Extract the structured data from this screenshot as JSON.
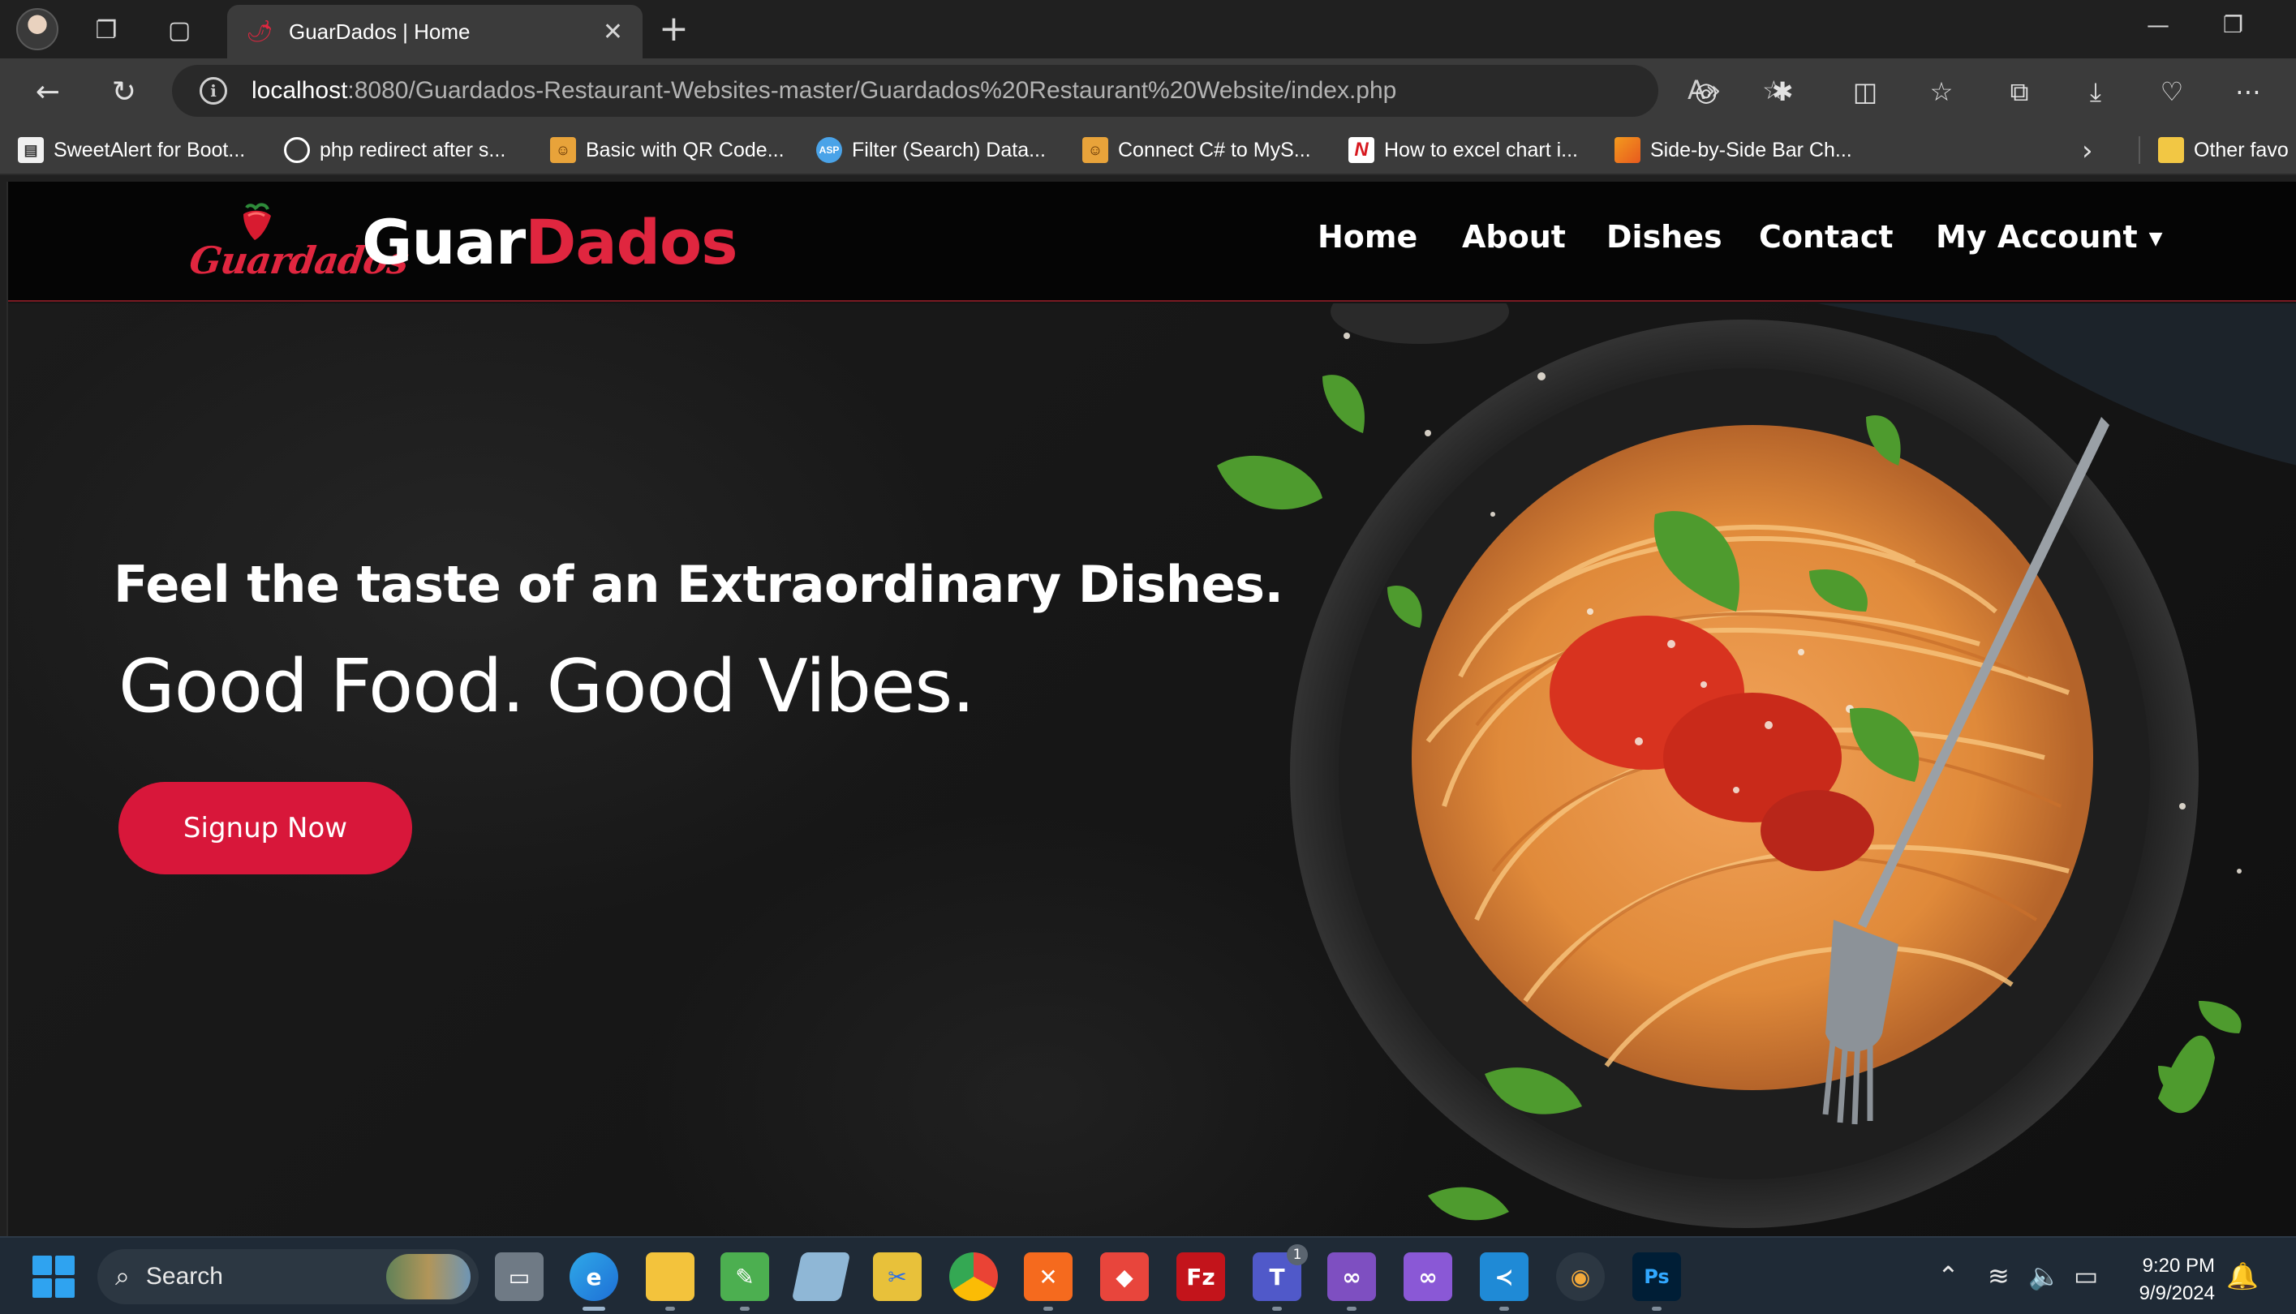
{
  "browser": {
    "tab_title": "GuarDados | Home",
    "url_host": "localhost",
    "url_path": ":8080/Guardados-Restaurant-Websites-master/Guardados%20Restaurant%20Website/index.php",
    "bookmarks": [
      {
        "label": "SweetAlert for Boot...",
        "icon": "sweetalert-icon"
      },
      {
        "label": "php redirect after s...",
        "icon": "github-icon"
      },
      {
        "label": "Basic with QR Code...",
        "icon": "blog-icon"
      },
      {
        "label": "Filter (Search) Data...",
        "icon": "aspnet-icon"
      },
      {
        "label": "Connect C# to MyS...",
        "icon": "blog-icon"
      },
      {
        "label": "How to excel chart i...",
        "icon": "n-icon"
      },
      {
        "label": "Side-by-Side Bar Ch...",
        "icon": "chart-icon"
      }
    ],
    "other_favorites": "Other favo"
  },
  "site": {
    "brand_part1": "Guar",
    "brand_part2": "Dados",
    "logo_text": "Guardados",
    "nav": {
      "home": "Home",
      "about": "About",
      "dishes": "Dishes",
      "contact": "Contact",
      "account": "My Account"
    },
    "hero": {
      "subtitle": "Feel the taste of an Extraordinary Dishes.",
      "title": "Good Food. Good Vibes.",
      "cta": "Signup Now"
    },
    "colors": {
      "accent": "#e0263f",
      "button": "#d8173a",
      "nav_bg": "#050505"
    }
  },
  "taskbar": {
    "search_placeholder": "Search",
    "time": "9:20 PM",
    "date": "9/9/2024",
    "teams_badge": "1"
  }
}
